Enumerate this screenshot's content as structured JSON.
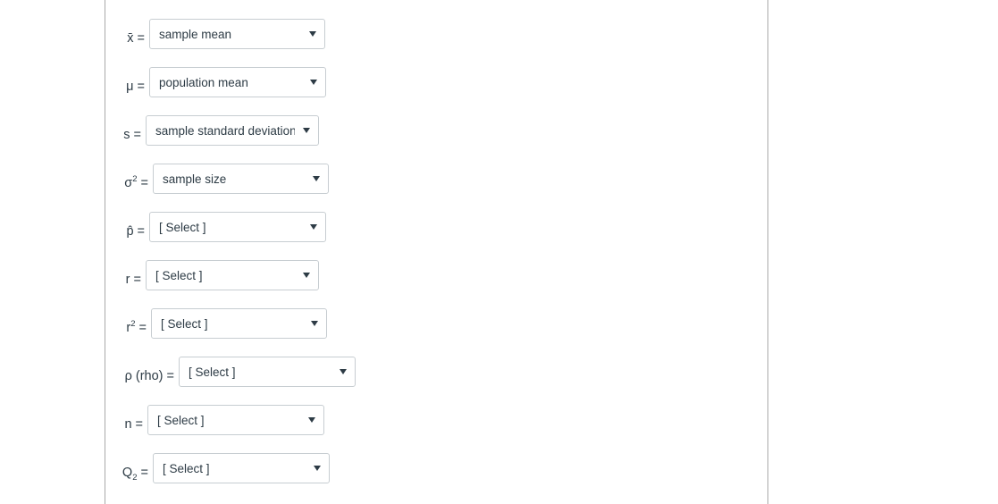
{
  "page": {
    "background_color": "#ffffff",
    "rule_color": "#a9a9a9",
    "text_color": "#2d3b45",
    "border_color": "#c7cdd1"
  },
  "placeholder": "[ Select ]",
  "rows": [
    {
      "id": "sample-mean",
      "symbol_html": "x̄ =",
      "symbol_text": "x̄ =",
      "value": "sample mean",
      "select_width": 197,
      "label_width": 30
    },
    {
      "id": "population-mean",
      "symbol_html": "μ =",
      "symbol_text": "μ =",
      "value": "population mean",
      "select_width": 198,
      "label_width": 30
    },
    {
      "id": "sample-standard-deviation",
      "symbol_html": "s =",
      "symbol_text": "s =",
      "value": "sample standard deviation",
      "select_width": 194,
      "label_width": 26
    },
    {
      "id": "sigma-squared",
      "symbol_html": "σ<sup>2</sup> =",
      "symbol_text": "σ² =",
      "value": "sample size",
      "select_width": 197,
      "label_width": 34
    },
    {
      "id": "p-hat",
      "symbol_html": "p̂ =",
      "symbol_text": "p̂ =",
      "value": "[ Select ]",
      "select_width": 198,
      "label_width": 30
    },
    {
      "id": "r",
      "symbol_html": "r =",
      "symbol_text": "r =",
      "value": "[ Select ]",
      "select_width": 194,
      "label_width": 26
    },
    {
      "id": "r-squared",
      "symbol_html": "r<sup>2</sup> =",
      "symbol_text": "r² =",
      "value": "[ Select ]",
      "select_width": 197,
      "label_width": 32
    },
    {
      "id": "rho",
      "symbol_html": "ρ (rho) =",
      "symbol_text": "ρ (rho) =",
      "value": "[ Select ]",
      "select_width": 198,
      "label_width": 63
    },
    {
      "id": "n",
      "symbol_html": "n =",
      "symbol_text": "n =",
      "value": "[ Select ]",
      "select_width": 198,
      "label_width": 28
    },
    {
      "id": "q2",
      "symbol_html": "Q<sub>2</sub> =",
      "symbol_text": "Q₂ =",
      "value": "[ Select ]",
      "select_width": 198,
      "label_width": 34
    }
  ]
}
